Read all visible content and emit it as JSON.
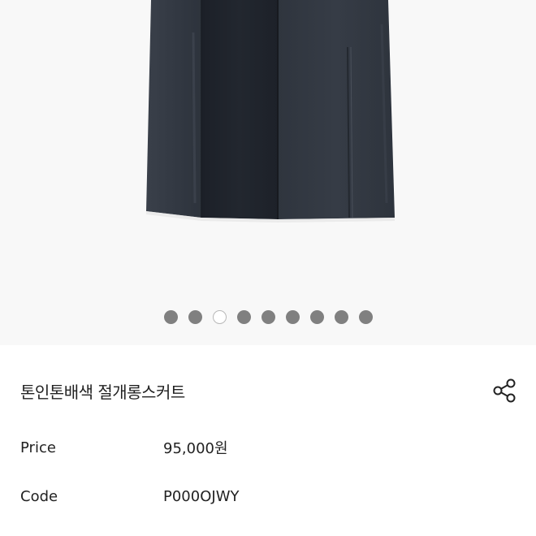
{
  "gallery": {
    "image_alt": "",
    "dots_count": 9,
    "active_index": 2
  },
  "product": {
    "title": "톤인톤배색 절개롱스커트",
    "price_label": "Price",
    "price_value": "95,000원",
    "code_label": "Code",
    "code_value": "P000OJWY"
  },
  "icons": {
    "share": "share-icon"
  },
  "colors": {
    "background": "#ffffff",
    "gallery_background": "#f8f8f8",
    "dot_inactive": "#808080",
    "dot_active": "#ffffff",
    "skirt_dark": "#1f242d",
    "skirt_gray": "#353b44"
  }
}
